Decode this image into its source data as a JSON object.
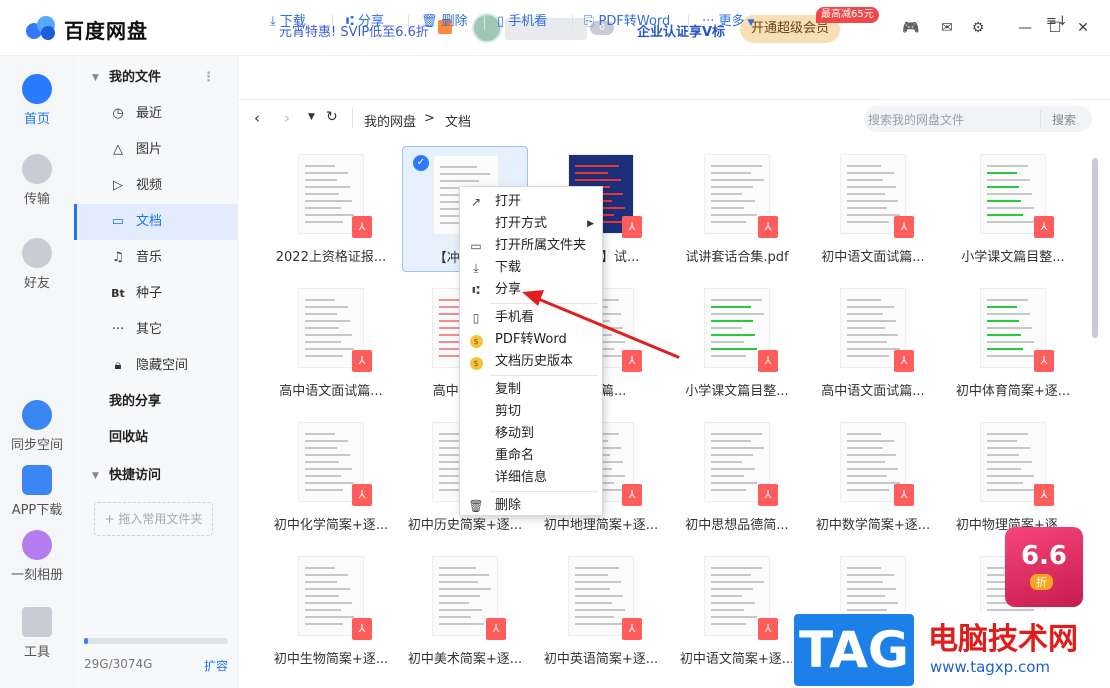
{
  "app": {
    "title": "百度网盘",
    "promo": "元宵特惠! SVIP低至6.6折",
    "corp": "企业认证享V标",
    "svip": "开通超级会员",
    "svip_badge": "最高减65元",
    "vip_level": "0"
  },
  "leftnav": [
    {
      "label": "首页",
      "active": true
    },
    {
      "label": "传输"
    },
    {
      "label": "好友"
    },
    {
      "label": "同步空间"
    },
    {
      "label": "APP下载"
    },
    {
      "label": "一刻相册"
    },
    {
      "label": "工具"
    }
  ],
  "sidebar": {
    "my_files": "我的文件",
    "items": [
      {
        "icon": "clock",
        "label": "最近"
      },
      {
        "icon": "image",
        "label": "图片"
      },
      {
        "icon": "play",
        "label": "视频"
      },
      {
        "icon": "doc",
        "label": "文档",
        "active": true
      },
      {
        "icon": "music",
        "label": "音乐"
      },
      {
        "icon": "Bt",
        "label": "种子"
      },
      {
        "icon": "more",
        "label": "其它"
      },
      {
        "icon": "lock",
        "label": "隐藏空间"
      }
    ],
    "my_share": "我的分享",
    "recycle": "回收站",
    "quick": "快捷访问",
    "add_folder": "+ 拖入常用文件夹",
    "quota": "29G/3074G",
    "expand": "扩容",
    "quota_fraction": 0.009
  },
  "toolbar": {
    "download": "下载",
    "share": "分享",
    "delete": "删除",
    "phone": "手机看",
    "pdf": "PDF转Word",
    "more": "更多"
  },
  "path": {
    "root": "我的网盘",
    "current": "文档",
    "search_placeholder": "搜索我的网盘文件",
    "search_btn": "搜索"
  },
  "files": [
    [
      "2022上资格证报...",
      "【冲刺之...",
      "【...议】试...",
      "试讲套话合集.pdf",
      "初中语文面试篇...",
      "小学课文篇目整..."
    ],
    [
      "高中语文面试篇...",
      "高中语文...",
      "...试篇...",
      "小学课文篇目整...",
      "高中语文面试篇...",
      "初中体育简案+逐..."
    ],
    [
      "初中化学简案+逐...",
      "初中历史简案+逐...",
      "初中地理简案+逐...",
      "初中思想品德简...",
      "初中数学简案+逐...",
      "初中物理简案+逐..."
    ],
    [
      "初中生物简案+逐...",
      "初中美术简案+逐...",
      "初中英语简案+逐...",
      "初中语文简案+逐...",
      "",
      ""
    ]
  ],
  "menu": [
    {
      "icon": "open",
      "label": "打开"
    },
    {
      "icon": "",
      "label": "打开方式",
      "sub": true
    },
    {
      "icon": "folder",
      "label": "打开所属文件夹"
    },
    {
      "icon": "download",
      "label": "下载"
    },
    {
      "icon": "share",
      "label": "分享"
    },
    {
      "sep": true
    },
    {
      "icon": "phone",
      "label": "手机看"
    },
    {
      "icon": "coin",
      "label": "PDF转Word"
    },
    {
      "icon": "coin",
      "label": "文档历史版本"
    },
    {
      "sep": true
    },
    {
      "label": "复制"
    },
    {
      "label": "剪切"
    },
    {
      "label": "移动到"
    },
    {
      "label": "重命名"
    },
    {
      "label": "详细信息"
    },
    {
      "sep": true
    },
    {
      "icon": "trash",
      "label": "删除"
    }
  ],
  "promo_badge": {
    "num": "6.6",
    "unit": "折"
  },
  "watermark": {
    "tag": "TAG",
    "cn": "电脑技术网",
    "url": "www.tagxp.com"
  }
}
